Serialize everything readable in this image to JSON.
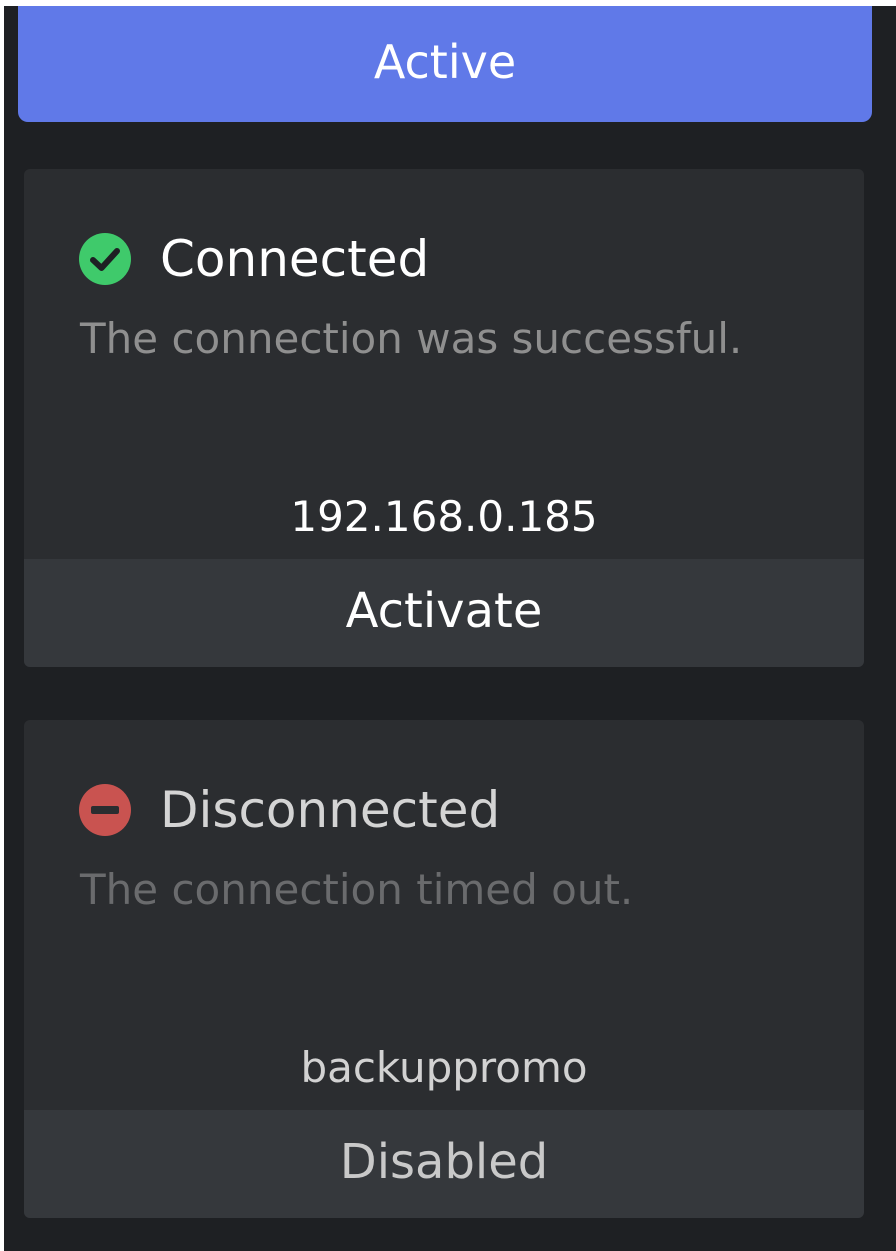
{
  "header": {
    "active_label": "Active",
    "accent_color": "#6079e8"
  },
  "connections": [
    {
      "status": "Connected",
      "status_icon": "check-circle-icon",
      "status_color": "#3fca6b",
      "description": "The connection was successful.",
      "address": "192.168.0.185",
      "action_label": "Activate"
    },
    {
      "status": "Disconnected",
      "status_icon": "minus-circle-icon",
      "status_color": "#c95350",
      "description": "The connection timed out.",
      "address": "backuppromo",
      "action_label": "Disabled"
    }
  ]
}
